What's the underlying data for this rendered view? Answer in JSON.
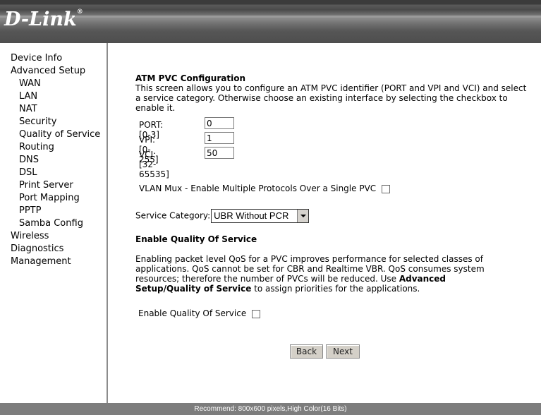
{
  "header": {
    "logo_text": "D-Link",
    "logo_mark": "®"
  },
  "sidebar": {
    "items": [
      {
        "label": "Device Info"
      },
      {
        "label": "Advanced Setup"
      },
      {
        "label": "WAN"
      },
      {
        "label": "LAN"
      },
      {
        "label": "NAT"
      },
      {
        "label": "Security"
      },
      {
        "label": "Quality of Service"
      },
      {
        "label": "Routing"
      },
      {
        "label": "DNS"
      },
      {
        "label": "DSL"
      },
      {
        "label": "Print Server"
      },
      {
        "label": "Port Mapping"
      },
      {
        "label": "PPTP"
      },
      {
        "label": "Samba Config"
      },
      {
        "label": "Wireless"
      },
      {
        "label": "Diagnostics"
      },
      {
        "label": "Management"
      }
    ]
  },
  "main": {
    "title": "ATM PVC Configuration",
    "description": "This screen allows you to configure an ATM PVC identifier (PORT and VPI and VCI) and select a service category. Otherwise choose an existing interface by selecting the checkbox to enable it.",
    "fields": {
      "port": {
        "label": "PORT: [0-3]",
        "value": "0"
      },
      "vpi": {
        "label": "VPI: [0-255]",
        "value": "1"
      },
      "vci": {
        "label": "VCI: [32-65535]",
        "value": "50"
      }
    },
    "vlan_mux_label": "VLAN Mux - Enable Multiple Protocols Over a Single PVC",
    "service_category_label": "Service Category:",
    "service_category_value": "UBR Without PCR",
    "qos_heading": "Enable Quality Of Service",
    "qos_desc_part1": "Enabling packet level QoS for a PVC improves performance for selected classes of applications.  QoS cannot be set for CBR and Realtime VBR.  QoS consumes system resources; therefore the number of PVCs will be reduced. Use ",
    "qos_desc_bold": "Advanced Setup/Quality of Service",
    "qos_desc_part2": " to assign priorities for the applications.",
    "qos_enable_label": "Enable Quality Of Service",
    "back_label": "Back",
    "next_label": "Next"
  },
  "footer": {
    "text": "Recommend: 800x600 pixels,High Color(16 Bits)"
  },
  "colors": {
    "header": "#4e4e4e",
    "footer": "#7d7d7d",
    "sidebar_border": "#8c8c8c"
  }
}
